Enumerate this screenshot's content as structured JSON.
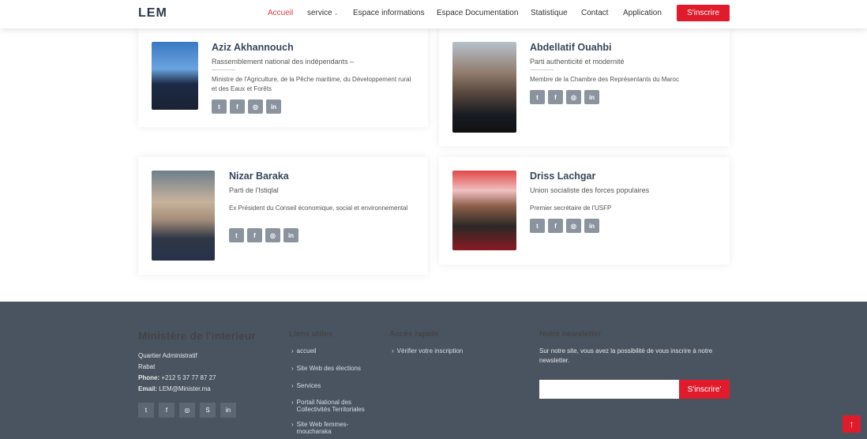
{
  "header": {
    "logo": "LEM",
    "menu": [
      "Accueil",
      "service",
      "Espace informations",
      "Espace Documentation",
      "Statistique",
      "Contact",
      "Application"
    ],
    "signup_label": "S'inscrire"
  },
  "members": [
    {
      "name": "Aziz Akhannouch",
      "party": "Rassemblement national des indépendants –",
      "role": "Ministre de l'Agriculture, de la Pêche maritime, du Développement rural et des Eaux et Forêts"
    },
    {
      "name": "Abdellatif Ouahbi",
      "party": "Parti authenticité et modernité",
      "role": "Membre de la Chambre des Représentants du Maroc"
    },
    {
      "name": "Nizar Baraka",
      "party": "Parti de l'Istiqlal",
      "role": "Ex Président du Conseil économique, social et environnemental"
    },
    {
      "name": "Driss Lachgar",
      "party": "Union socialiste des forces populaires",
      "role": "Premier secrétaire de l'USFP"
    }
  ],
  "social_icons": [
    "twitter-icon",
    "facebook-icon",
    "instagram-icon",
    "linkedin-icon"
  ],
  "footer": {
    "title": "Ministère de l'interieur",
    "address1": "Quartier Administratif",
    "address2": "Rabat",
    "phone_label": "Phone:",
    "phone": "+212 5 37 77 87 27",
    "email_label": "Email:",
    "email": "LEM@Minister.ma",
    "useful_title": "Liens utiles",
    "useful_links": [
      "accueil",
      "Site Web des élections",
      "Services",
      "Portail National des Collectivités Territoriales",
      "Site Web femmes-moucharaka"
    ],
    "quick_title": "Accès rapide",
    "quick_links": [
      "Vérifier votre inscription"
    ],
    "newsletter_title": "Notre newsletter",
    "newsletter_text": "Sur notre site, vous avez la possibilité de vous inscrire à notre newsletter.",
    "newsletter_button": "S'inscrire'",
    "social_icons": [
      "twitter-icon",
      "facebook-icon",
      "instagram-icon",
      "skype-icon",
      "linkedin-icon"
    ]
  },
  "colors": {
    "accent": "#e01b2c",
    "footer_bg": "#4a5461",
    "social_bg": "#8b949e"
  }
}
